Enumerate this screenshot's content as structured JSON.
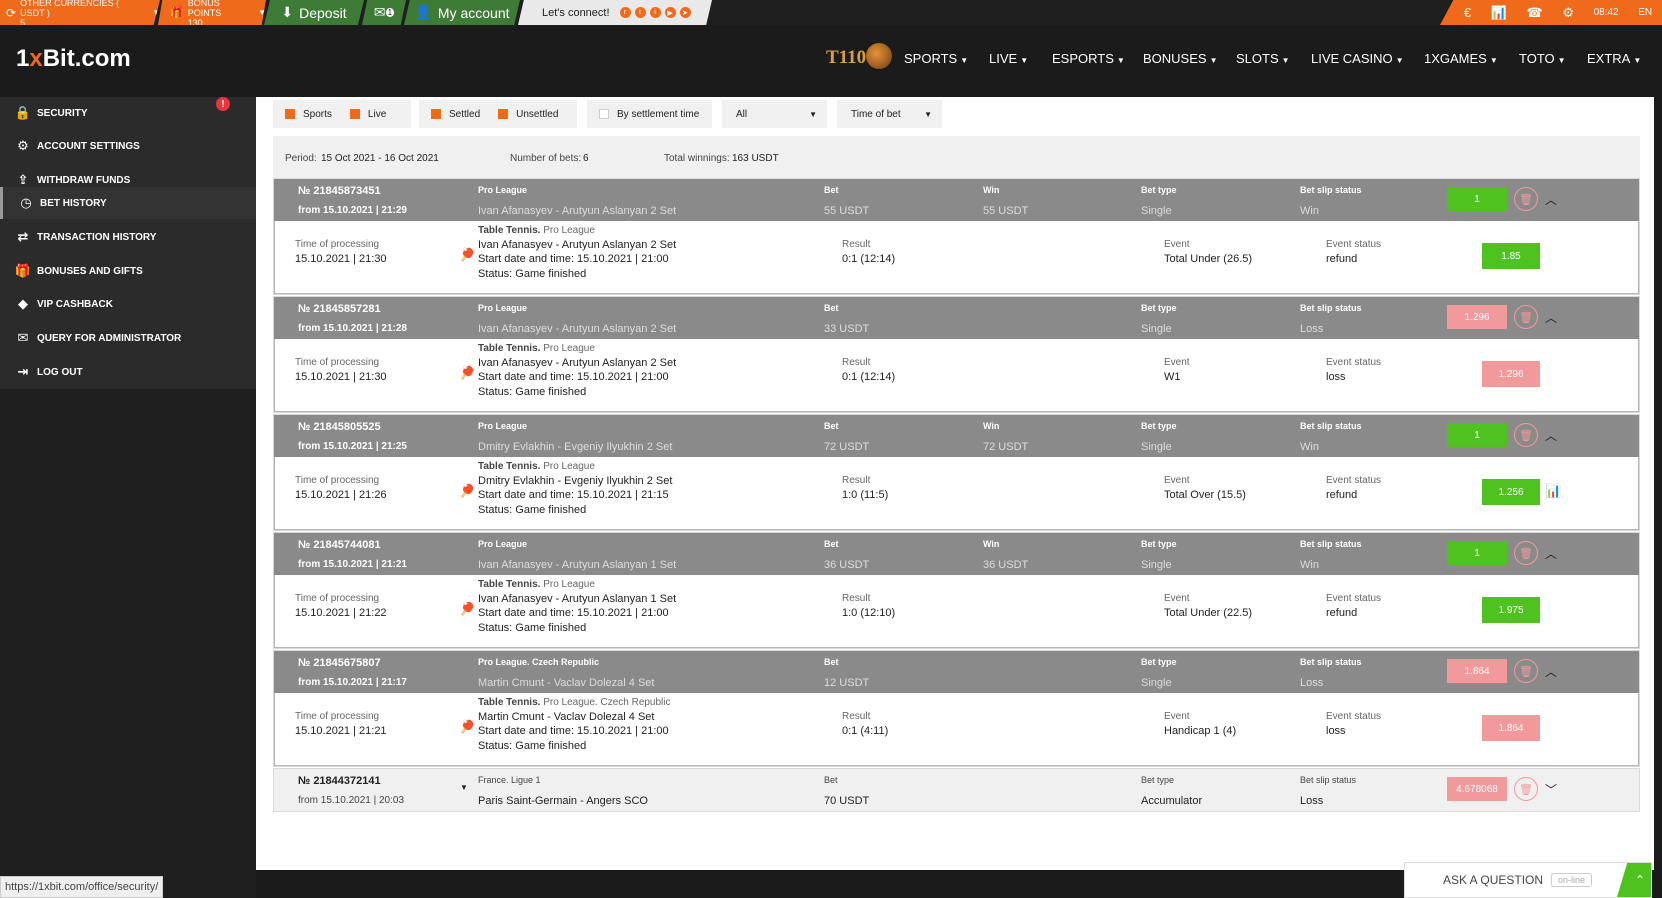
{
  "topbar": {
    "currencies_label": "OTHER CURRENCIES ( USDT )",
    "currencies_count": "5",
    "bonus_label": "BONUS POINTS",
    "bonus_value": "130",
    "deposit_label": "Deposit",
    "mail_badge": "1",
    "account_label": "My account",
    "connect_label": "Let's connect!",
    "time": "08:42",
    "lang": "EN"
  },
  "header": {
    "logo_main": "1",
    "logo_x": "x",
    "logo_rest": "Bit.com",
    "t10": "T110",
    "nav": [
      "SPORTS",
      "LIVE",
      "ESPORTS",
      "BONUSES",
      "SLOTS",
      "LIVE CASINO",
      "1XGAMES",
      "TOTO",
      "EXTRA"
    ]
  },
  "sidebar": {
    "items": [
      {
        "label": "SECURITY",
        "icon": "lock-icon"
      },
      {
        "label": "ACCOUNT SETTINGS",
        "icon": "gears-icon"
      },
      {
        "label": "WITHDRAW FUNDS",
        "icon": "upload-icon"
      },
      {
        "label": "BET HISTORY",
        "icon": "clock-icon"
      },
      {
        "label": "TRANSACTION HISTORY",
        "icon": "arrows-icon"
      },
      {
        "label": "BONUSES AND GIFTS",
        "icon": "gift-icon"
      },
      {
        "label": "VIP CASHBACK",
        "icon": "diamond-icon"
      },
      {
        "label": "QUERY FOR ADMINISTRATOR",
        "icon": "envelope-icon"
      },
      {
        "label": "LOG OUT",
        "icon": "logout-icon"
      }
    ],
    "alert": "!",
    "status_url": "https://1xbit.com/office/security/"
  },
  "filters": {
    "sports": "Sports",
    "live": "Live",
    "settled": "Settled",
    "unsettled": "Unsettled",
    "by_settlement": "By settlement time",
    "all": "All",
    "time_of_bet": "Time of bet"
  },
  "period": {
    "period_label": "Period:",
    "period_value": "15 Oct 2021 - 16 Oct 2021",
    "bets_label": "Number of bets:",
    "bets_value": "6",
    "winnings_label": "Total winnings:",
    "winnings_value": "163 USDT"
  },
  "labels": {
    "bet": "Bet",
    "win": "Win",
    "bet_type": "Bet type",
    "slip_status": "Bet slip status",
    "time_processing": "Time of processing",
    "result": "Result",
    "event": "Event",
    "event_status": "Event status",
    "sport": "Table Tennis."
  },
  "bets": [
    {
      "num": "№ 21845873451",
      "from": "from 15.10.2021 | 21:29",
      "league": "Pro League",
      "match": "Ivan Afanasyev - Arutyun Aslanyan 2 Set",
      "bet": "55 USDT",
      "win": "55 USDT",
      "type": "Single",
      "status": "Win",
      "odd": "1",
      "proc_time": "15.10.2021 | 21:30",
      "sport_league": "Pro League",
      "start": "Start date and time: 15.10.2021 | 21:00",
      "game_status": "Status: Game finished",
      "result": "0:1 (12:14)",
      "event": "Total Under (26.5)",
      "event_status": "refund",
      "event_odd": "1.85"
    },
    {
      "num": "№ 21845857281",
      "from": "from 15.10.2021 | 21:28",
      "league": "Pro League",
      "match": "Ivan Afanasyev - Arutyun Aslanyan 2 Set",
      "bet": "33 USDT",
      "win": "",
      "type": "Single",
      "status": "Loss",
      "odd": "1.296",
      "proc_time": "15.10.2021 | 21:30",
      "sport_league": "Pro League",
      "start": "Start date and time: 15.10.2021 | 21:00",
      "game_status": "Status: Game finished",
      "result": "0:1 (12:14)",
      "event": "W1",
      "event_status": "loss",
      "event_odd": "1.296"
    },
    {
      "num": "№ 21845805525",
      "from": "from 15.10.2021 | 21:25",
      "league": "Pro League",
      "match": "Dmitry Evlakhin - Evgeniy Ilyukhin 2 Set",
      "bet": "72 USDT",
      "win": "72 USDT",
      "type": "Single",
      "status": "Win",
      "odd": "1",
      "proc_time": "15.10.2021 | 21:26",
      "sport_league": "Pro League",
      "start": "Start date and time: 15.10.2021 | 21:15",
      "game_status": "Status: Game finished",
      "result": "1:0 (11:5)",
      "event": "Total Over (15.5)",
      "event_status": "refund",
      "event_odd": "1.256"
    },
    {
      "num": "№ 21845744081",
      "from": "from 15.10.2021 | 21:21",
      "league": "Pro League",
      "match": "Ivan Afanasyev - Arutyun Aslanyan 1 Set",
      "bet": "36 USDT",
      "win": "36 USDT",
      "type": "Single",
      "status": "Win",
      "odd": "1",
      "proc_time": "15.10.2021 | 21:22",
      "sport_league": "Pro League",
      "start": "Start date and time: 15.10.2021 | 21:00",
      "game_status": "Status: Game finished",
      "result": "1:0 (12:10)",
      "event": "Total Under (22.5)",
      "event_status": "refund",
      "event_odd": "1.975"
    },
    {
      "num": "№ 21845675807",
      "from": "from 15.10.2021 | 21:17",
      "league": "Pro League. Czech Republic",
      "match": "Martin Cmunt - Vaclav Dolezal 4 Set",
      "bet": "12 USDT",
      "win": "",
      "type": "Single",
      "status": "Loss",
      "odd": "1.864",
      "proc_time": "15.10.2021 | 21:21",
      "sport_league": "Pro League. Czech Republic",
      "start": "Start date and time: 15.10.2021 | 21:00",
      "game_status": "Status: Game finished",
      "result": "0:1 (4:11)",
      "event": "Handicap 1 (4)",
      "event_status": "loss",
      "event_odd": "1.864"
    },
    {
      "num": "№ 21844372141",
      "from": "from 15.10.2021 | 20:03",
      "league": "France. Ligue 1",
      "match": "Paris Saint-Germain - Angers SCO",
      "bet": "70 USDT",
      "win": "",
      "type": "Accumulator",
      "status": "Loss",
      "odd": "4.678068"
    }
  ],
  "ask": {
    "label": "ASK A QUESTION",
    "badge": "on-line"
  },
  "colors": {
    "accent": "#f06a1b",
    "green": "#3e7b36",
    "win": "#4fc21f",
    "loss": "#f2999c"
  }
}
